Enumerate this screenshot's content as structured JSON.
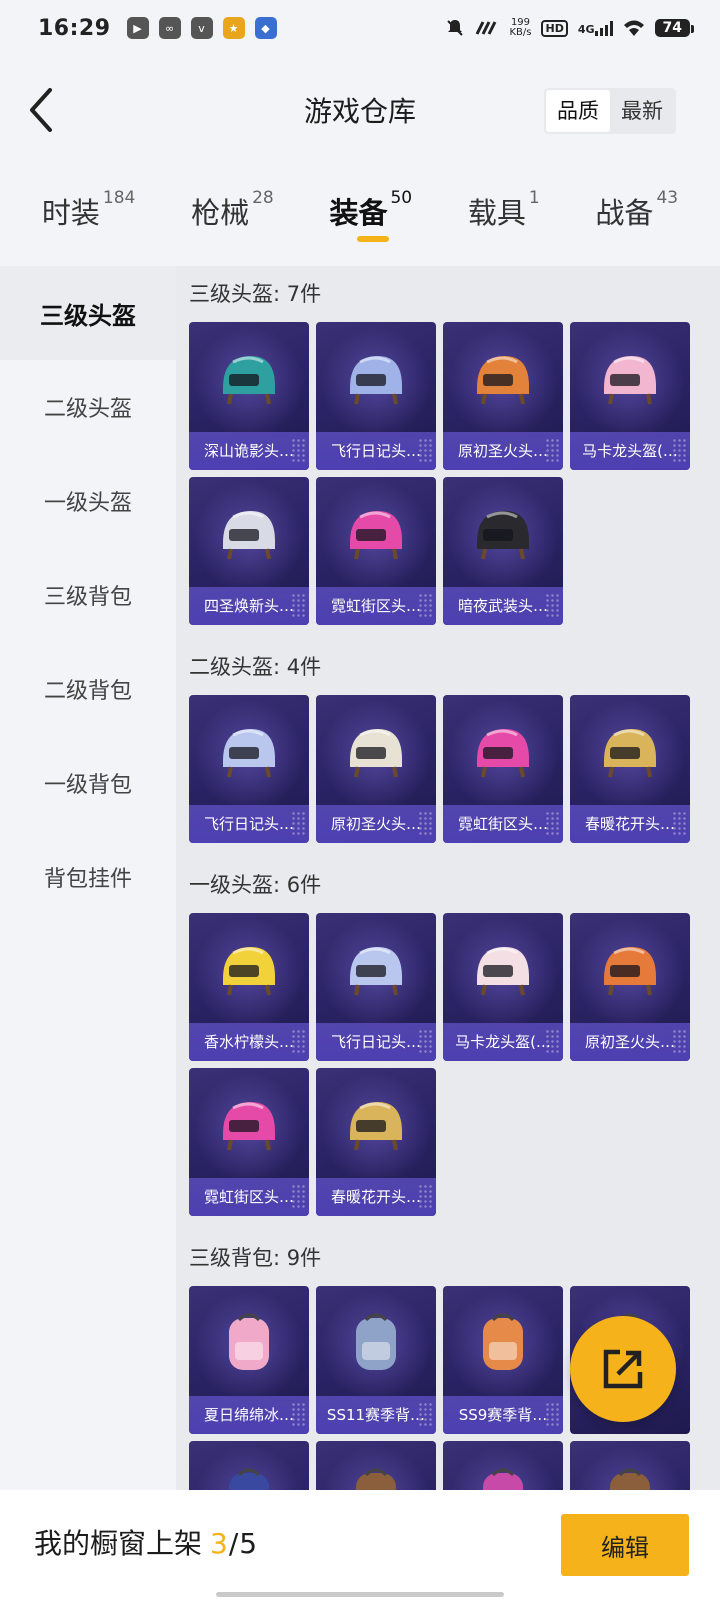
{
  "status_bar": {
    "time": "16:29",
    "net_speed_value": "199",
    "net_speed_unit": "KB/s",
    "hd": "HD",
    "net_type": "4G",
    "battery": "74"
  },
  "header": {
    "title": "游戏仓库",
    "sort_options": [
      "品质",
      "最新"
    ],
    "sort_active": "品质"
  },
  "tabs": [
    {
      "label": "时装",
      "count": "184"
    },
    {
      "label": "枪械",
      "count": "28"
    },
    {
      "label": "装备",
      "count": "50",
      "active": true
    },
    {
      "label": "载具",
      "count": "1"
    },
    {
      "label": "战备",
      "count": "43"
    }
  ],
  "sidebar": {
    "items": [
      "三级头盔",
      "二级头盔",
      "一级头盔",
      "三级背包",
      "二级背包",
      "一级背包",
      "背包挂件"
    ],
    "active": "三级头盔"
  },
  "sections": [
    {
      "title": "三级头盔: 7件",
      "items": [
        "深山诡影头…",
        "飞行日记头…",
        "原初圣火头…",
        "马卡龙头盔(…",
        "四圣焕新头…",
        "霓虹街区头…",
        "暗夜武装头…"
      ],
      "colors": [
        "#2fa0a0",
        "#9fb3e8",
        "#e2823b",
        "#f2b6d0",
        "#d8dbe6",
        "#e64aa8",
        "#2a2a2e"
      ]
    },
    {
      "title": "二级头盔: 4件",
      "items": [
        "飞行日记头…",
        "原初圣火头…",
        "霓虹街区头…",
        "春暖花开头…"
      ],
      "colors": [
        "#b9c6ee",
        "#e8e2d4",
        "#e64aa8",
        "#d9b45a"
      ]
    },
    {
      "title": "一级头盔: 6件",
      "items": [
        "香水柠檬头…",
        "飞行日记头…",
        "马卡龙头盔(…",
        "原初圣火头…",
        "霓虹街区头…",
        "春暖花开头…"
      ],
      "colors": [
        "#f2d23b",
        "#b9c6ee",
        "#f3dfe4",
        "#e57a3a",
        "#e64aa8",
        "#d9b45a"
      ]
    },
    {
      "title": "三级背包: 9件",
      "items": [
        "夏日绵绵冰…",
        "SS11赛季背…",
        "SS9赛季背…",
        "",
        "",
        "",
        "",
        ""
      ],
      "colors": [
        "#f0a9c8",
        "#8fa2c8",
        "#e68a4a",
        "#3b3f55",
        "#3a49a0",
        "#8b5e3c",
        "#c74aa8",
        "#8b5e3c"
      ]
    }
  ],
  "bottom_bar": {
    "label": "我的橱窗上架",
    "current": "3",
    "slash": "/",
    "total": "5",
    "edit_label": "编辑"
  },
  "accent_color": "#f5b21b"
}
